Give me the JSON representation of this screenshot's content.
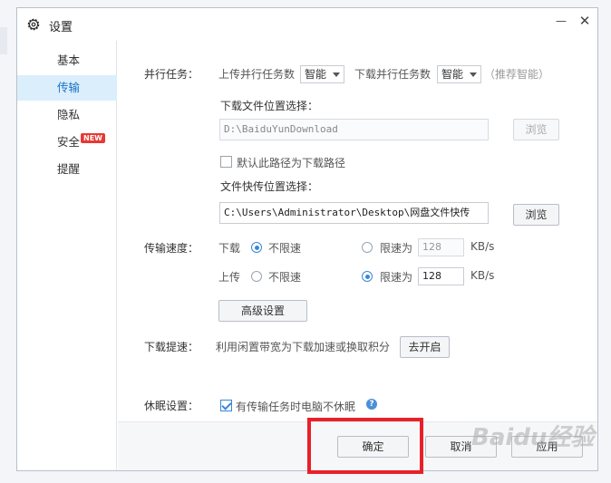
{
  "window": {
    "title": "设置",
    "minimize": "—",
    "close": "✕"
  },
  "sidebar": {
    "items": [
      {
        "label": "基本"
      },
      {
        "label": "传输"
      },
      {
        "label": "隐私"
      },
      {
        "label": "安全"
      },
      {
        "label": "提醒"
      }
    ],
    "active_index": 1,
    "new_badge": "NEW"
  },
  "parallel": {
    "label": "并行任务：",
    "upload_label": "上传并行任务数",
    "upload_value": "智能",
    "download_label": "下载并行任务数",
    "download_value": "智能",
    "hint": "（推荐智能）"
  },
  "download_location": {
    "label": "下载文件位置选择：",
    "path": "D:\\BaiduYunDownload",
    "browse": "浏览",
    "default_checkbox": "默认此路径为下载路径",
    "default_checked": false
  },
  "quick_upload": {
    "label": "文件快传位置选择：",
    "path": "C:\\Users\\Administrator\\Desktop\\网盘文件快传",
    "browse": "浏览"
  },
  "speed": {
    "label": "传输速度：",
    "download_label": "下载",
    "upload_label": "上传",
    "unlimited": "不限速",
    "limit": "限速为",
    "download_limit_value": "128",
    "upload_limit_value": "128",
    "unit": "KB/s",
    "download_mode": "unlimited",
    "upload_mode": "limited",
    "advanced": "高级设置"
  },
  "accelerate": {
    "label": "下载提速：",
    "desc": "利用闲置带宽为下载加速或换取积分",
    "button": "去开启"
  },
  "sleep": {
    "label": "休眠设置：",
    "checkbox": "有传输任务时电脑不休眠",
    "checked": true,
    "help": "?"
  },
  "footer": {
    "ok": "确定",
    "cancel": "取消",
    "apply": "应用"
  },
  "watermark": "Baidu经验",
  "colors": {
    "accent": "#3a87d6",
    "active_bg": "#dbeefb",
    "highlight_box": "#e8202a"
  }
}
